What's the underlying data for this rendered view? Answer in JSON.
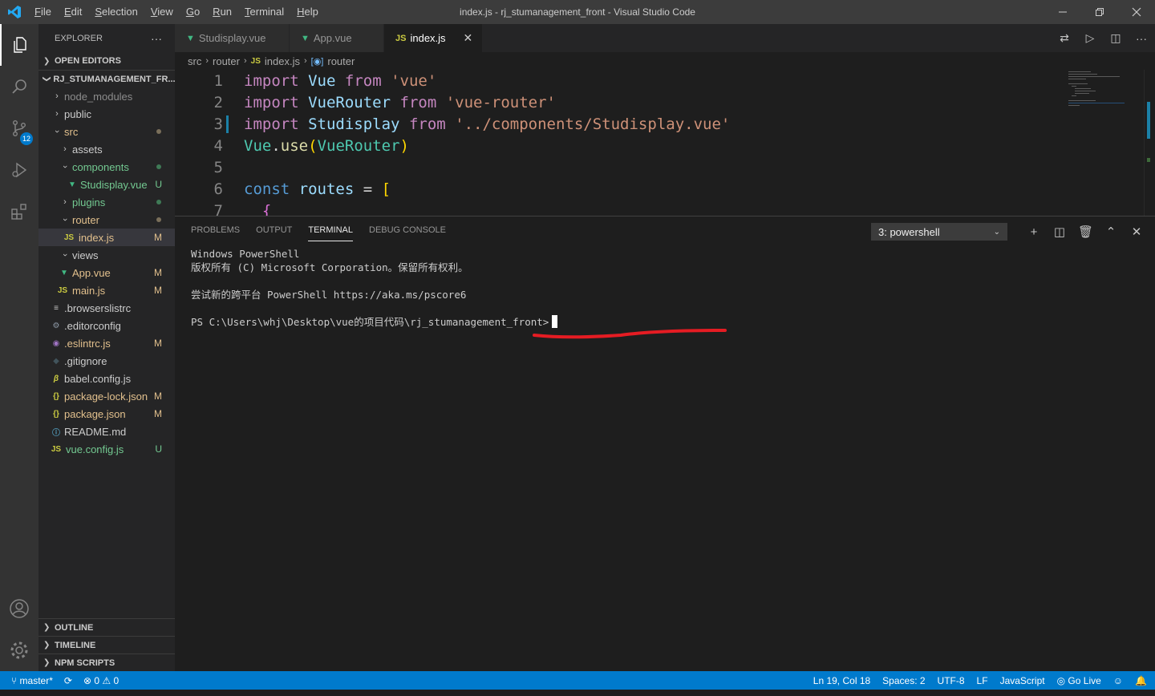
{
  "titlebar": {
    "menu": [
      "File",
      "Edit",
      "Selection",
      "View",
      "Go",
      "Run",
      "Terminal",
      "Help"
    ],
    "title": "index.js - rj_stumanagement_front - Visual Studio Code"
  },
  "activity": {
    "scm_badge": "12"
  },
  "sidebar": {
    "header": "EXPLORER",
    "more": "···",
    "open_editors": "OPEN EDITORS",
    "project": "RJ_STUMANAGEMENT_FR...",
    "items": [
      {
        "label": "node_modules",
        "status": ""
      },
      {
        "label": "public",
        "status": ""
      },
      {
        "label": "src",
        "status": ""
      },
      {
        "label": "assets",
        "status": ""
      },
      {
        "label": "components",
        "status": ""
      },
      {
        "label": "Studisplay.vue",
        "status": "U"
      },
      {
        "label": "plugins",
        "status": ""
      },
      {
        "label": "router",
        "status": ""
      },
      {
        "label": "index.js",
        "status": "M"
      },
      {
        "label": "views",
        "status": ""
      },
      {
        "label": "App.vue",
        "status": "M"
      },
      {
        "label": "main.js",
        "status": "M"
      },
      {
        "label": ".browserslistrc",
        "status": ""
      },
      {
        "label": ".editorconfig",
        "status": ""
      },
      {
        "label": ".eslintrc.js",
        "status": "M"
      },
      {
        "label": ".gitignore",
        "status": ""
      },
      {
        "label": "babel.config.js",
        "status": ""
      },
      {
        "label": "package-lock.json",
        "status": "M"
      },
      {
        "label": "package.json",
        "status": "M"
      },
      {
        "label": "README.md",
        "status": ""
      },
      {
        "label": "vue.config.js",
        "status": "U"
      }
    ],
    "outline": "OUTLINE",
    "timeline": "TIMELINE",
    "npm_scripts": "NPM SCRIPTS"
  },
  "tabs": [
    {
      "label": "Studisplay.vue",
      "icon": "vue-icon"
    },
    {
      "label": "App.vue",
      "icon": "vue-icon"
    },
    {
      "label": "index.js",
      "icon": "js-icon",
      "close": "✕"
    }
  ],
  "breadcrumb": {
    "parts": [
      "src",
      "router",
      "index.js",
      "router"
    ],
    "js_badge": "JS"
  },
  "editor": {
    "line_numbers": [
      "1",
      "2",
      "3",
      "4",
      "5",
      "6",
      "7"
    ],
    "lines": [
      [
        {
          "t": "import",
          "c": "kw"
        },
        {
          "t": " "
        },
        {
          "t": "Vue",
          "c": "var"
        },
        {
          "t": " "
        },
        {
          "t": "from",
          "c": "kw"
        },
        {
          "t": " "
        },
        {
          "t": "'vue'",
          "c": "str"
        }
      ],
      [
        {
          "t": "import",
          "c": "kw"
        },
        {
          "t": " "
        },
        {
          "t": "VueRouter",
          "c": "var"
        },
        {
          "t": " "
        },
        {
          "t": "from",
          "c": "kw"
        },
        {
          "t": " "
        },
        {
          "t": "'vue-router'",
          "c": "str"
        }
      ],
      [
        {
          "t": "import",
          "c": "kw"
        },
        {
          "t": " "
        },
        {
          "t": "Studisplay",
          "c": "var"
        },
        {
          "t": " "
        },
        {
          "t": "from",
          "c": "kw"
        },
        {
          "t": " "
        },
        {
          "t": "'../components/Studisplay.vue'",
          "c": "str"
        }
      ],
      [
        {
          "t": "Vue",
          "c": "cls"
        },
        {
          "t": ".",
          "c": "pun"
        },
        {
          "t": "use",
          "c": "fn"
        },
        {
          "t": "(",
          "c": "br"
        },
        {
          "t": "VueRouter",
          "c": "cls"
        },
        {
          "t": ")",
          "c": "br"
        }
      ],
      [],
      [
        {
          "t": "const",
          "c": "kb"
        },
        {
          "t": " "
        },
        {
          "t": "routes",
          "c": "var"
        },
        {
          "t": " = ",
          "c": "pun"
        },
        {
          "t": "[",
          "c": "br"
        }
      ],
      [
        {
          "t": "  "
        },
        {
          "t": "{",
          "c": "br2"
        }
      ]
    ]
  },
  "panel": {
    "tabs": [
      "PROBLEMS",
      "OUTPUT",
      "TERMINAL",
      "DEBUG CONSOLE"
    ],
    "active_tab": "TERMINAL",
    "terminal_select": "3: powershell",
    "terminal_lines": [
      "Windows PowerShell",
      "版权所有 (C) Microsoft Corporation。保留所有权利。",
      "",
      "尝试新的跨平台 PowerShell https://aka.ms/pscore6",
      "",
      "PS C:\\Users\\whj\\Desktop\\vue的项目代码\\rj_stumanagement_front>"
    ]
  },
  "statusbar": {
    "branch": "master*",
    "errors": "0",
    "warnings": "0",
    "position": "Ln 19, Col 18",
    "spaces": "Spaces: 2",
    "encoding": "UTF-8",
    "eol": "LF",
    "language": "JavaScript",
    "golive": "Go Live"
  },
  "colors": {
    "accent": "#007acc",
    "modified": "#e2c08d",
    "untracked": "#73c991",
    "annotation": "#e51c23"
  }
}
